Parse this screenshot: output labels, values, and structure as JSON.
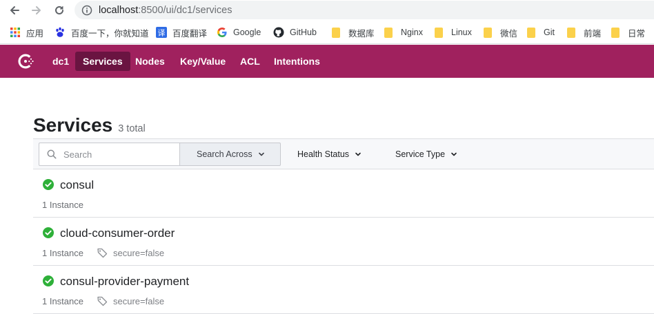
{
  "browser": {
    "url_host": "localhost",
    "url_path": ":8500/ui/dc1/services",
    "bookmarks": [
      {
        "label": "应用",
        "icon": "apps-grid-icon"
      },
      {
        "label": "百度一下，你就知道",
        "icon": "baidu-paw-icon"
      },
      {
        "label": "百度翻译",
        "icon": "baidu-translate-icon"
      },
      {
        "label": "Google",
        "icon": "google-icon"
      },
      {
        "label": "GitHub",
        "icon": "github-icon"
      },
      {
        "label": "数据库",
        "icon": "folder-icon"
      },
      {
        "label": "Nginx",
        "icon": "folder-icon"
      },
      {
        "label": "Linux",
        "icon": "folder-icon"
      },
      {
        "label": "微信",
        "icon": "folder-icon"
      },
      {
        "label": "Git",
        "icon": "folder-icon"
      },
      {
        "label": "前端",
        "icon": "folder-icon"
      },
      {
        "label": "日常",
        "icon": "folder-icon"
      }
    ]
  },
  "header": {
    "brand_color": "#a0215e",
    "datacenter": "dc1",
    "nav": [
      {
        "label": "Services",
        "active": true
      },
      {
        "label": "Nodes",
        "active": false
      },
      {
        "label": "Key/Value",
        "active": false
      },
      {
        "label": "ACL",
        "active": false
      },
      {
        "label": "Intentions",
        "active": false
      }
    ]
  },
  "page": {
    "title": "Services",
    "count": "3 total"
  },
  "filters": {
    "search_placeholder": "Search",
    "search_across": "Search Across",
    "health_status": "Health Status",
    "service_type": "Service Type"
  },
  "services": [
    {
      "name": "consul",
      "instances": "1 Instance",
      "tag": "",
      "status": "passing"
    },
    {
      "name": "cloud-consumer-order",
      "instances": "1 Instance",
      "tag": "secure=false",
      "status": "passing"
    },
    {
      "name": "consul-provider-payment",
      "instances": "1 Instance",
      "tag": "secure=false",
      "status": "passing"
    }
  ],
  "colors": {
    "passing": "#2eb039",
    "active_nav": "#6a1441"
  }
}
